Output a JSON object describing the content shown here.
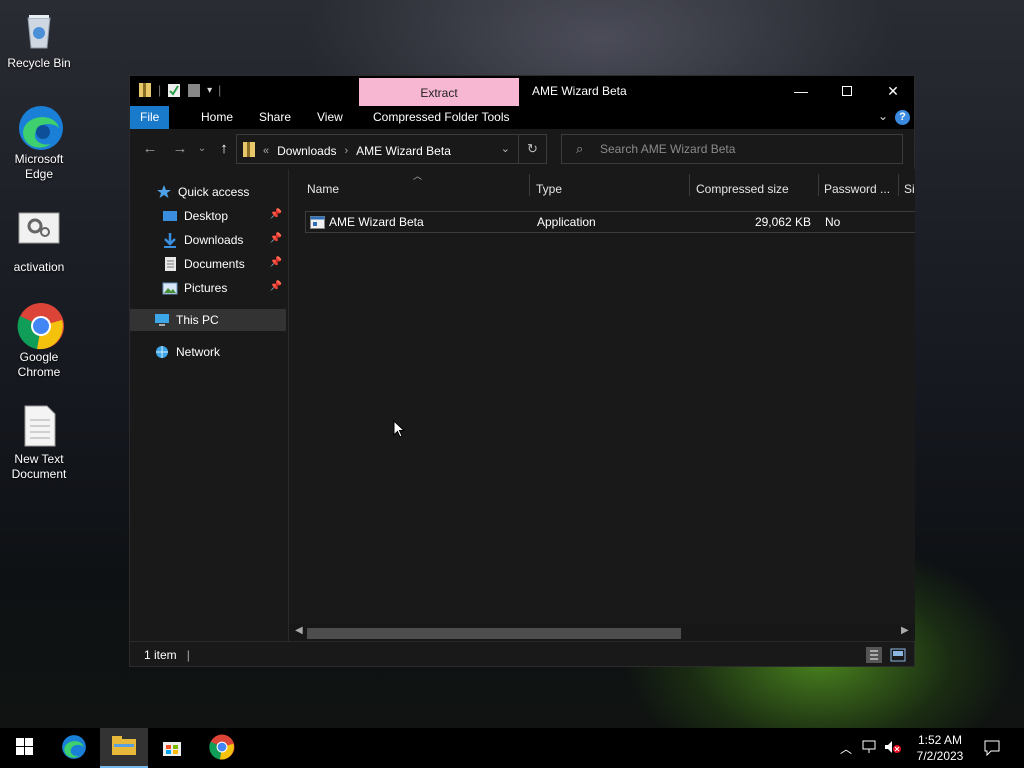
{
  "desktop": {
    "icons": [
      {
        "label": "Recycle Bin",
        "icon": "recycle-bin-icon"
      },
      {
        "label": "Microsoft Edge",
        "icon": "edge-icon"
      },
      {
        "label": "activation",
        "icon": "settings-file-icon"
      },
      {
        "label": "Google Chrome",
        "icon": "chrome-icon"
      },
      {
        "label": "New Text Document",
        "icon": "text-document-icon"
      }
    ]
  },
  "window": {
    "title": "AME Wizard Beta",
    "context_tab": "Extract",
    "ribbon_tabs": [
      "File",
      "Home",
      "Share",
      "View",
      "Compressed Folder Tools"
    ],
    "address": {
      "overflow": "«",
      "crumbs": [
        "Downloads",
        "AME Wizard Beta"
      ]
    },
    "search": {
      "placeholder": "Search AME Wizard Beta"
    },
    "nav_pane": [
      {
        "label": "Quick access",
        "icon": "star-icon"
      },
      {
        "label": "Desktop",
        "icon": "desktop-folder-icon",
        "pinned": true
      },
      {
        "label": "Downloads",
        "icon": "download-icon",
        "pinned": true
      },
      {
        "label": "Documents",
        "icon": "documents-icon",
        "pinned": true
      },
      {
        "label": "Pictures",
        "icon": "pictures-icon",
        "pinned": true
      },
      {
        "label": "This PC",
        "icon": "computer-icon",
        "selected": true
      },
      {
        "label": "Network",
        "icon": "network-icon"
      }
    ],
    "columns": [
      "Name",
      "Type",
      "Compressed size",
      "Password ...",
      "Si"
    ],
    "files": [
      {
        "name": "AME Wizard Beta",
        "type": "Application",
        "compressed_size": "29,062 KB",
        "password": "No"
      }
    ],
    "status": {
      "item_count": "1 item"
    }
  },
  "taskbar": {
    "apps": [
      "start-icon",
      "edge-icon",
      "file-explorer-icon",
      "store-icon",
      "chrome-icon"
    ],
    "clock": {
      "time": "1:52 AM",
      "date": "7/2/2023"
    }
  },
  "colors": {
    "accent": "#1979ca",
    "context_tab": "#f7b7d3",
    "window_bg": "#191919",
    "taskbar_active": "#76b9ed"
  }
}
